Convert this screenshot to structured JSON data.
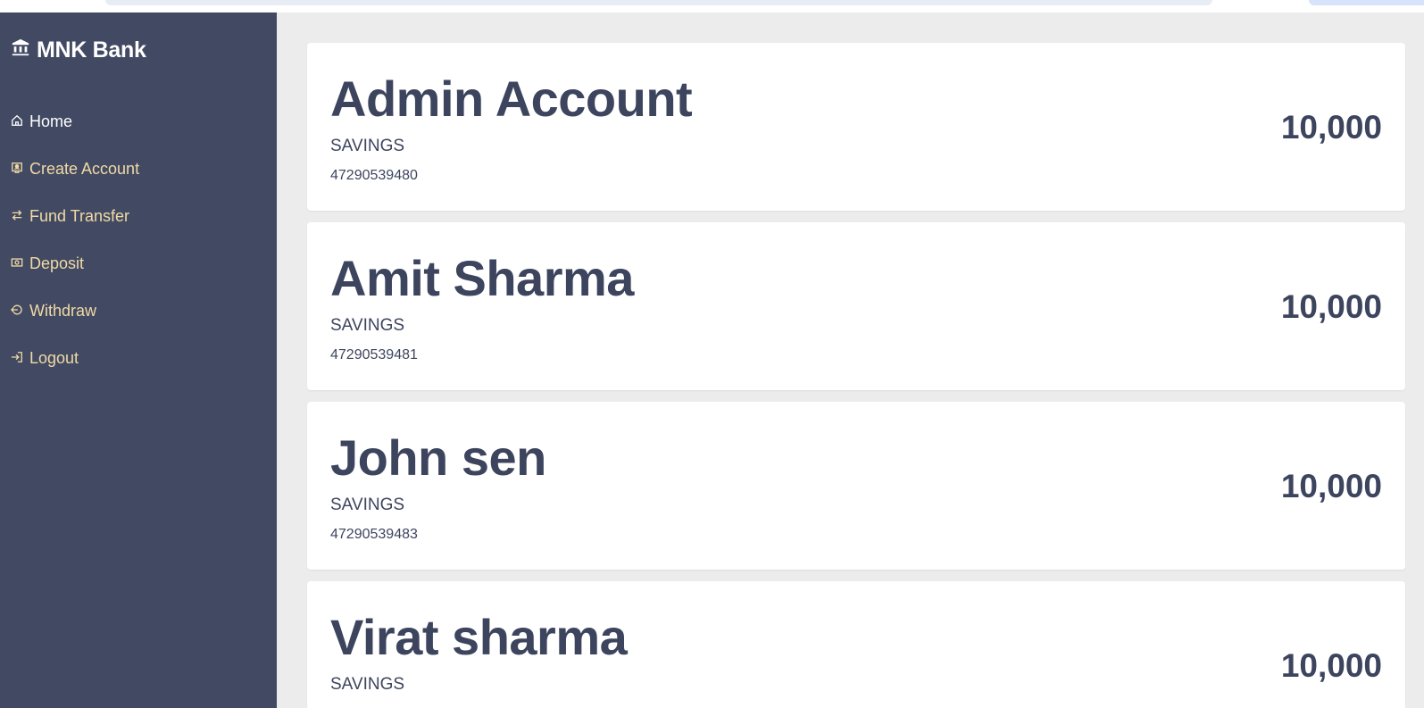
{
  "brand": {
    "name": "MNK Bank",
    "icon": "bank-icon"
  },
  "sidebar": {
    "items": [
      {
        "label": "Home",
        "icon": "home-icon",
        "active": true
      },
      {
        "label": "Create Account",
        "icon": "user-badge-icon",
        "active": false
      },
      {
        "label": "Fund Transfer",
        "icon": "transfer-arrows-icon",
        "active": false
      },
      {
        "label": "Deposit",
        "icon": "cash-icon",
        "active": false
      },
      {
        "label": "Withdraw",
        "icon": "withdraw-icon",
        "active": false
      },
      {
        "label": "Logout",
        "icon": "logout-icon",
        "active": false
      }
    ]
  },
  "accounts": [
    {
      "name": "Admin Account",
      "type": "SAVINGS",
      "number": "47290539480",
      "balance": "10,000"
    },
    {
      "name": "Amit Sharma",
      "type": "SAVINGS",
      "number": "47290539481",
      "balance": "10,000"
    },
    {
      "name": "John sen",
      "type": "SAVINGS",
      "number": "47290539483",
      "balance": "10,000"
    },
    {
      "name": "Virat sharma",
      "type": "SAVINGS",
      "balance": "10,000"
    }
  ],
  "colors": {
    "sidebar_bg": "#424a63",
    "sidebar_link": "#f0d9a5",
    "text_dark": "#3d455e",
    "page_bg": "#ececec"
  }
}
